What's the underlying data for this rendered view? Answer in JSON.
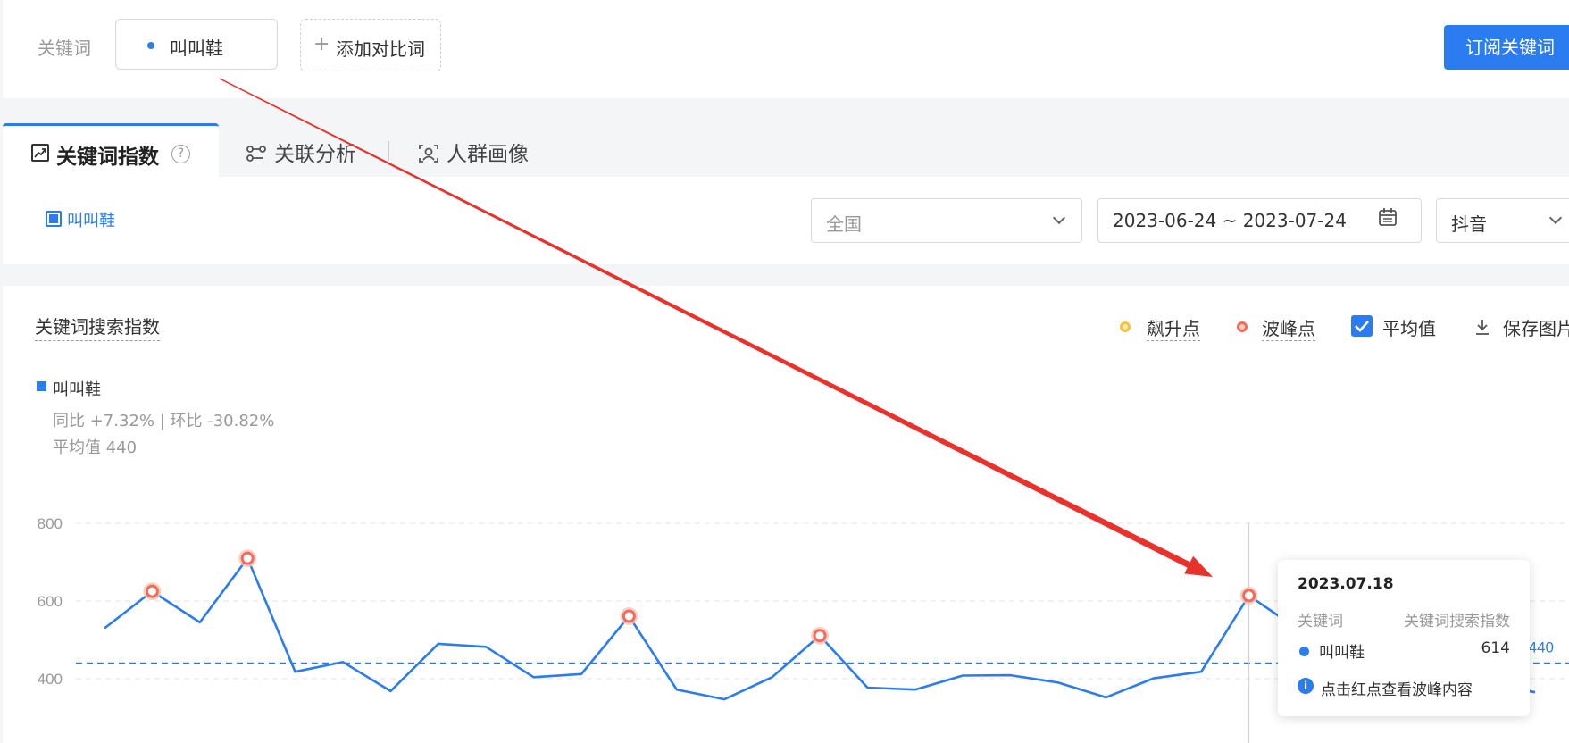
{
  "header": {
    "keyword_label": "关键词",
    "keyword": "叫叫鞋",
    "add_compare": "添加对比词",
    "subscribe_button": "订阅关键词"
  },
  "tabs": [
    {
      "label": "关键词指数",
      "icon": "trend-chart-icon",
      "active": true
    },
    {
      "label": "关联分析",
      "icon": "relation-icon",
      "active": false
    },
    {
      "label": "人群画像",
      "icon": "portrait-icon",
      "active": false
    }
  ],
  "filters": {
    "legend_keyword": "叫叫鞋",
    "region": "全国",
    "date_range": "2023-06-24 ~ 2023-07-24",
    "platform": "抖音"
  },
  "chart_panel": {
    "title": "关键词搜索指数",
    "rising_point": "飙升点",
    "peak_point": "波峰点",
    "average": "平均值",
    "save_image": "保存图片",
    "series_name": "叫叫鞋",
    "yoy": "同比 +7.32% | 环比 -30.82%",
    "avg_text": "平均值 440",
    "avg_value_label": "440"
  },
  "tooltip": {
    "date": "2023.07.18",
    "col_keyword": "关键词",
    "col_index": "关键词搜索指数",
    "keyword": "叫叫鞋",
    "value": "614",
    "hint": "点击红点查看波峰内容"
  },
  "colors": {
    "accent": "#2b7cf0",
    "peak": "#f26c5a",
    "rising": "#f5c242",
    "annotation_arrow": "#e8322b"
  },
  "chart_data": {
    "type": "line",
    "title": "关键词搜索指数",
    "ylim": [
      330,
      800
    ],
    "yticks": [
      400,
      600,
      800
    ],
    "series": [
      {
        "name": "叫叫鞋",
        "values": [
          530,
          625,
          545,
          710,
          418,
          443,
          368,
          490,
          482,
          404,
          412,
          561,
          372,
          347,
          404,
          511,
          377,
          372,
          408,
          409,
          390,
          352,
          401,
          418,
          614,
          530,
          340,
          345,
          352,
          390,
          365
        ]
      }
    ],
    "peak_indices": [
      1,
      3,
      11,
      15,
      24
    ],
    "average": 440,
    "hover_index": 24
  }
}
